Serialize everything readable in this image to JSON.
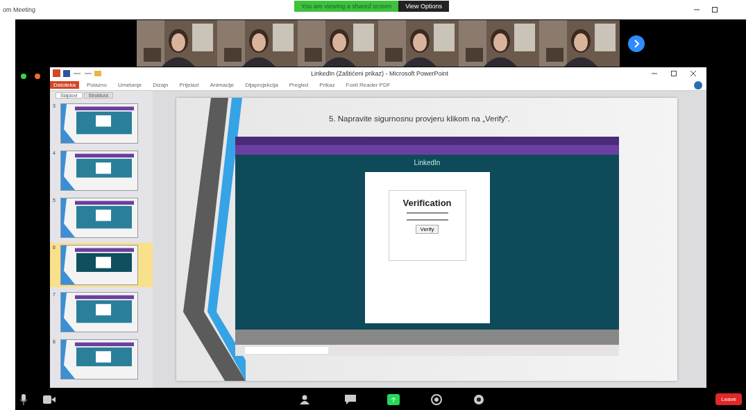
{
  "window": {
    "title": "om Meeting"
  },
  "share_banner": {
    "text": "You are viewing a shared screen",
    "options": "View Options"
  },
  "powerpoint": {
    "title": "LinkedIn (Zaštićeni prikaz) - Microsoft PowerPoint",
    "ribbon_tabs": [
      {
        "label": "Datoteka",
        "selected": true
      },
      {
        "label": "Polazno",
        "selected": false
      },
      {
        "label": "Umetanje",
        "selected": false
      },
      {
        "label": "Dizajn",
        "selected": false
      },
      {
        "label": "Prijelazi",
        "selected": false
      },
      {
        "label": "Animacije",
        "selected": false
      },
      {
        "label": "Dijaprojekcija",
        "selected": false
      },
      {
        "label": "Pregled",
        "selected": false
      },
      {
        "label": "Prikaz",
        "selected": false
      },
      {
        "label": "Foxit Reader PDF",
        "selected": false
      }
    ],
    "panel_tabs": [
      {
        "label": "Slajdovi",
        "selected": true
      },
      {
        "label": "Struktura",
        "selected": false
      }
    ],
    "slides": [
      {
        "number": "3",
        "selected": false
      },
      {
        "number": "4",
        "selected": false
      },
      {
        "number": "5",
        "selected": false
      },
      {
        "number": "6",
        "selected": true
      },
      {
        "number": "7",
        "selected": false
      },
      {
        "number": "8",
        "selected": false
      }
    ],
    "slide": {
      "heading": "5. Napravite sigurnosnu provjeru klikom na „Verify\".",
      "logo": "LinkedIn",
      "dialog_heading": "Verification",
      "dialog_button": "Verify"
    }
  },
  "toolbar": {
    "leave": "Leave"
  }
}
